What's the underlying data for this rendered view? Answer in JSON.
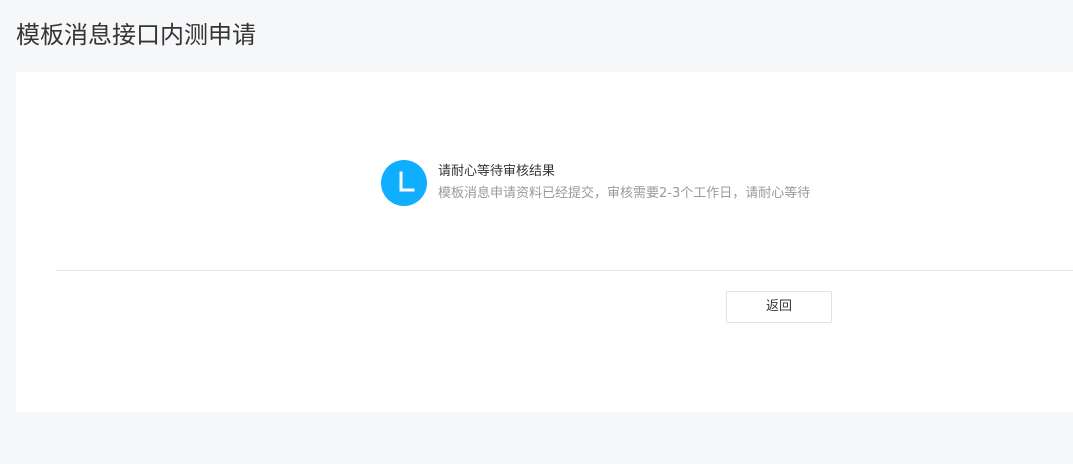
{
  "page": {
    "title": "模板消息接口内测申请"
  },
  "status": {
    "icon": "clock-icon",
    "icon_color": "#10aeff",
    "title": "请耐心等待审核结果",
    "description": "模板消息申请资料已经提交，审核需要2-3个工作日，请耐心等待"
  },
  "actions": {
    "back_label": "返回"
  }
}
